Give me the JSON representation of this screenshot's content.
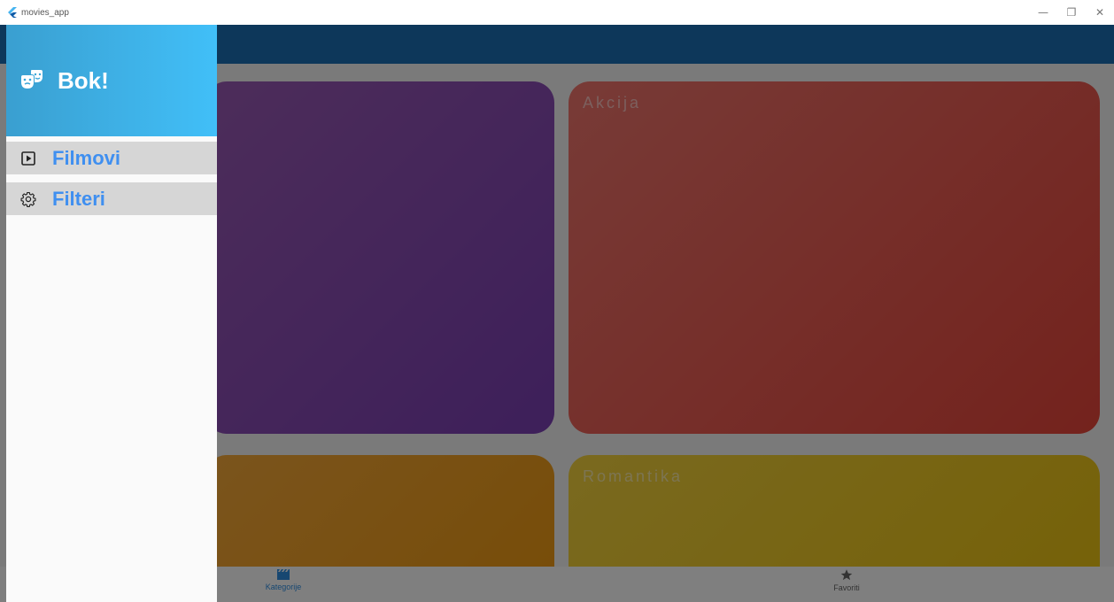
{
  "window": {
    "title": "movies_app",
    "controls": [
      "—",
      "❐",
      "✕"
    ]
  },
  "drawer": {
    "greeting": "Bok!",
    "items": [
      {
        "label": "Filmovi",
        "icon": "play-box-icon"
      },
      {
        "label": "Filteri",
        "icon": "gear-icon"
      }
    ]
  },
  "categories": [
    {
      "label": "",
      "color": "#8e4fb4"
    },
    {
      "label": "Akcija",
      "color": "#ee5b52"
    },
    {
      "label": "",
      "color": "#f3a229"
    },
    {
      "label": "Romantika",
      "color": "#f1cb2a"
    }
  ],
  "bottom_nav": {
    "items": [
      {
        "label": "Kategorije",
        "icon": "clapperboard-icon",
        "active": true
      },
      {
        "label": "Favoriti",
        "icon": "star-icon",
        "active": false
      }
    ]
  },
  "colors": {
    "appbar": "#1a6fb4",
    "drawer_header_start": "#3a9fd0",
    "drawer_header_end": "#41bff8",
    "drawer_item_text": "#3f8ff0",
    "active_nav": "#2e8ee3"
  }
}
